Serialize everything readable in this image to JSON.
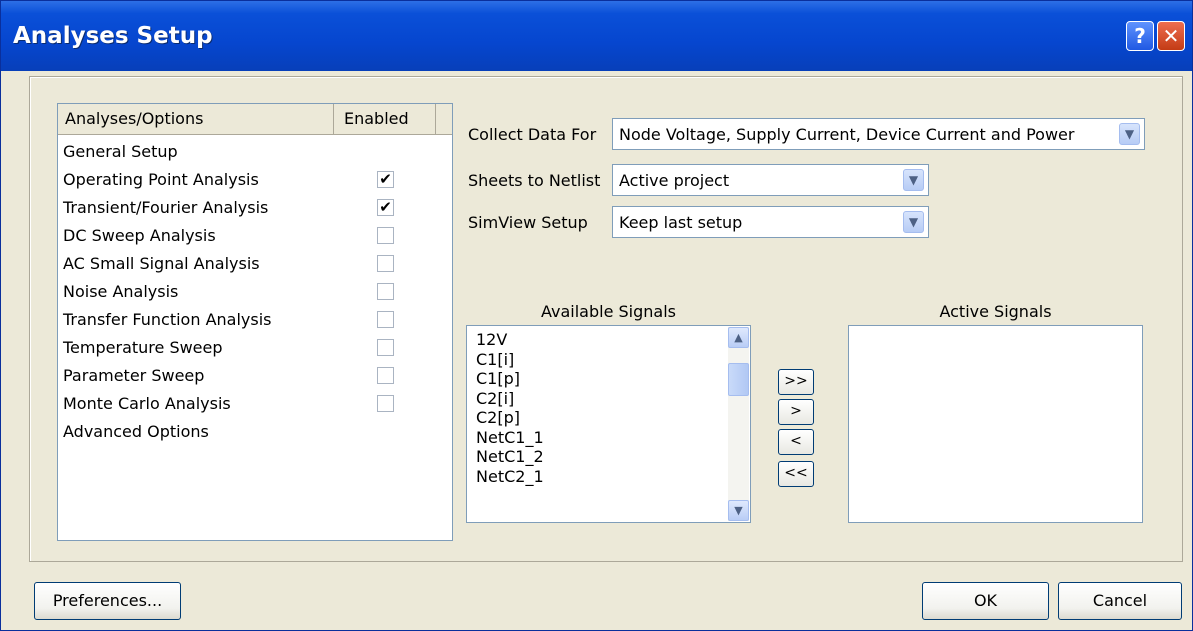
{
  "window": {
    "title": "Analyses Setup",
    "help_label": "?",
    "close_label": "✕"
  },
  "analyses": {
    "header_col1": "Analyses/Options",
    "header_col2": "Enabled",
    "rows": [
      {
        "label": "General Setup",
        "has_checkbox": false
      },
      {
        "label": "Operating Point Analysis",
        "has_checkbox": true,
        "checked": true,
        "mark": "✔"
      },
      {
        "label": "Transient/Fourier Analysis",
        "has_checkbox": true,
        "checked": true,
        "mark": "✔"
      },
      {
        "label": "DC Sweep Analysis",
        "has_checkbox": true,
        "checked": false,
        "mark": ""
      },
      {
        "label": "AC Small Signal Analysis",
        "has_checkbox": true,
        "checked": false,
        "mark": ""
      },
      {
        "label": "Noise Analysis",
        "has_checkbox": true,
        "checked": false,
        "mark": ""
      },
      {
        "label": "Transfer Function Analysis",
        "has_checkbox": true,
        "checked": false,
        "mark": ""
      },
      {
        "label": "Temperature Sweep",
        "has_checkbox": true,
        "checked": false,
        "mark": ""
      },
      {
        "label": "Parameter Sweep",
        "has_checkbox": true,
        "checked": false,
        "mark": ""
      },
      {
        "label": "Monte Carlo Analysis",
        "has_checkbox": true,
        "checked": false,
        "mark": ""
      },
      {
        "label": "Advanced Options",
        "has_checkbox": false
      }
    ]
  },
  "general": {
    "collect_label": "Collect Data For",
    "collect_value": "Node Voltage, Supply Current, Device Current and Power",
    "sheets_label": "Sheets to Netlist",
    "sheets_value": "Active project",
    "simview_label": "SimView Setup",
    "simview_value": "Keep last setup"
  },
  "signals": {
    "available_label": "Available Signals",
    "active_label": "Active Signals",
    "available": [
      "12V",
      "C1[i]",
      "C1[p]",
      "C2[i]",
      "C2[p]",
      "NetC1_1",
      "NetC1_2",
      "NetC2_1"
    ],
    "active": [],
    "move_all_right": ">>",
    "move_right": ">",
    "move_left": "<",
    "move_all_left": "<<"
  },
  "footer": {
    "preferences_label": "Preferences...",
    "ok_label": "OK",
    "cancel_label": "Cancel"
  }
}
